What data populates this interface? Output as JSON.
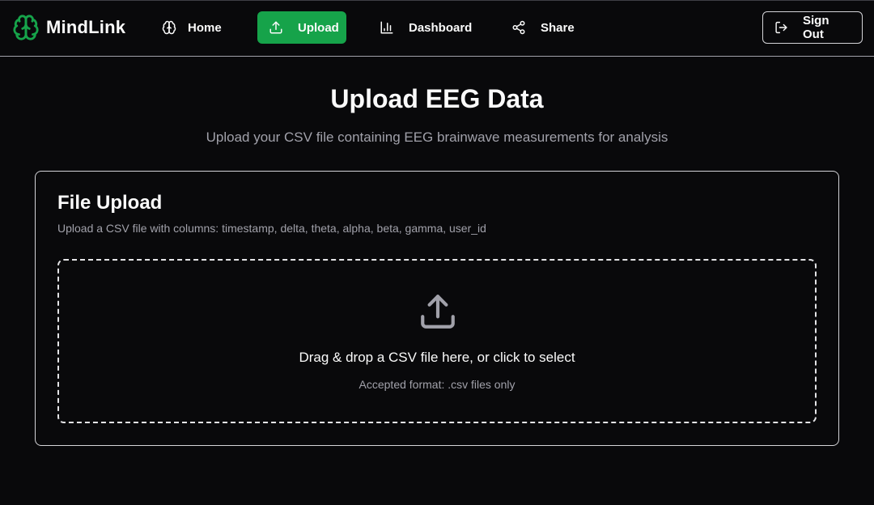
{
  "brand": {
    "name": "MindLink",
    "icon": "brain-icon",
    "color": "#16a34a"
  },
  "nav": {
    "items": [
      {
        "label": "Home",
        "icon": "brain-icon",
        "active": false
      },
      {
        "label": "Upload",
        "icon": "upload-icon",
        "active": true
      },
      {
        "label": "Dashboard",
        "icon": "bar-chart-icon",
        "active": false
      },
      {
        "label": "Share",
        "icon": "share-icon",
        "active": false
      }
    ],
    "sign_out": {
      "label": "Sign Out",
      "icon": "log-out-icon"
    },
    "active_color": "#16a34a"
  },
  "page": {
    "title": "Upload EEG Data",
    "subtitle": "Upload your CSV file containing EEG brainwave measurements for analysis"
  },
  "card": {
    "title": "File Upload",
    "description": "Upload a CSV file with columns: timestamp, delta, theta, alpha, beta, gamma, user_id",
    "dropzone": {
      "icon": "upload-icon",
      "main_text": "Drag & drop a CSV file here, or click to select",
      "sub_text": "Accepted format: .csv files only"
    }
  }
}
